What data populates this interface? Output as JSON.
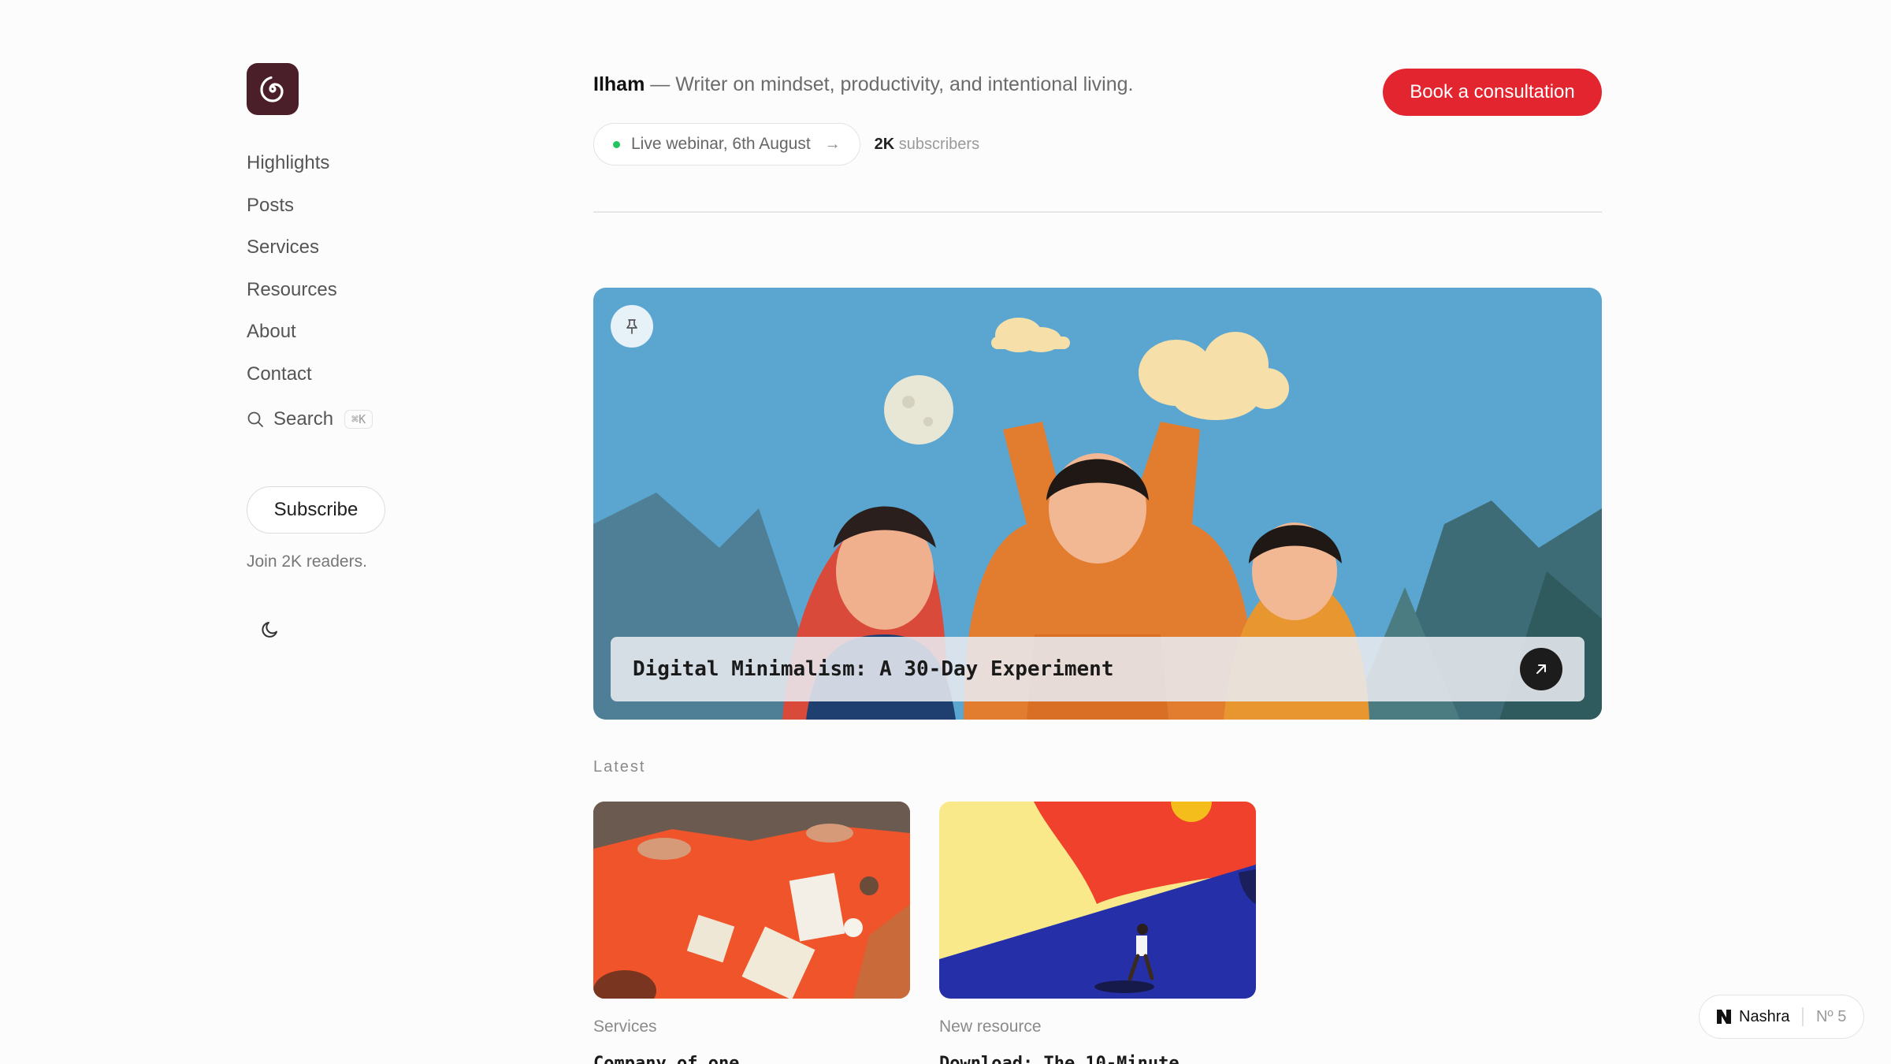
{
  "sidebar": {
    "nav": [
      "Highlights",
      "Posts",
      "Services",
      "Resources",
      "About",
      "Contact"
    ],
    "search_label": "Search",
    "search_shortcut": "⌘K",
    "subscribe_label": "Subscribe",
    "join_text": "Join 2K readers."
  },
  "header": {
    "name": "Ilham",
    "tagline": " — Writer on mindset, productivity, and intentional living.",
    "cta_label": "Book a consultation",
    "webinar_label": "Live webinar, 6th August",
    "subscribers_count": "2K",
    "subscribers_label": " subscribers"
  },
  "hero": {
    "title": "Digital Minimalism: A 30-Day Experiment"
  },
  "latest": {
    "label": "Latest",
    "cards": [
      {
        "category": "Services",
        "title": "Company of one"
      },
      {
        "category": "New resource",
        "title": "Download: The 10-Minute"
      }
    ]
  },
  "badge": {
    "brand": "Nashra",
    "issue": "Nº 5"
  },
  "colors": {
    "accent": "#e2252f",
    "logo_bg": "#4a1f2a",
    "live_dot": "#22c55e"
  }
}
